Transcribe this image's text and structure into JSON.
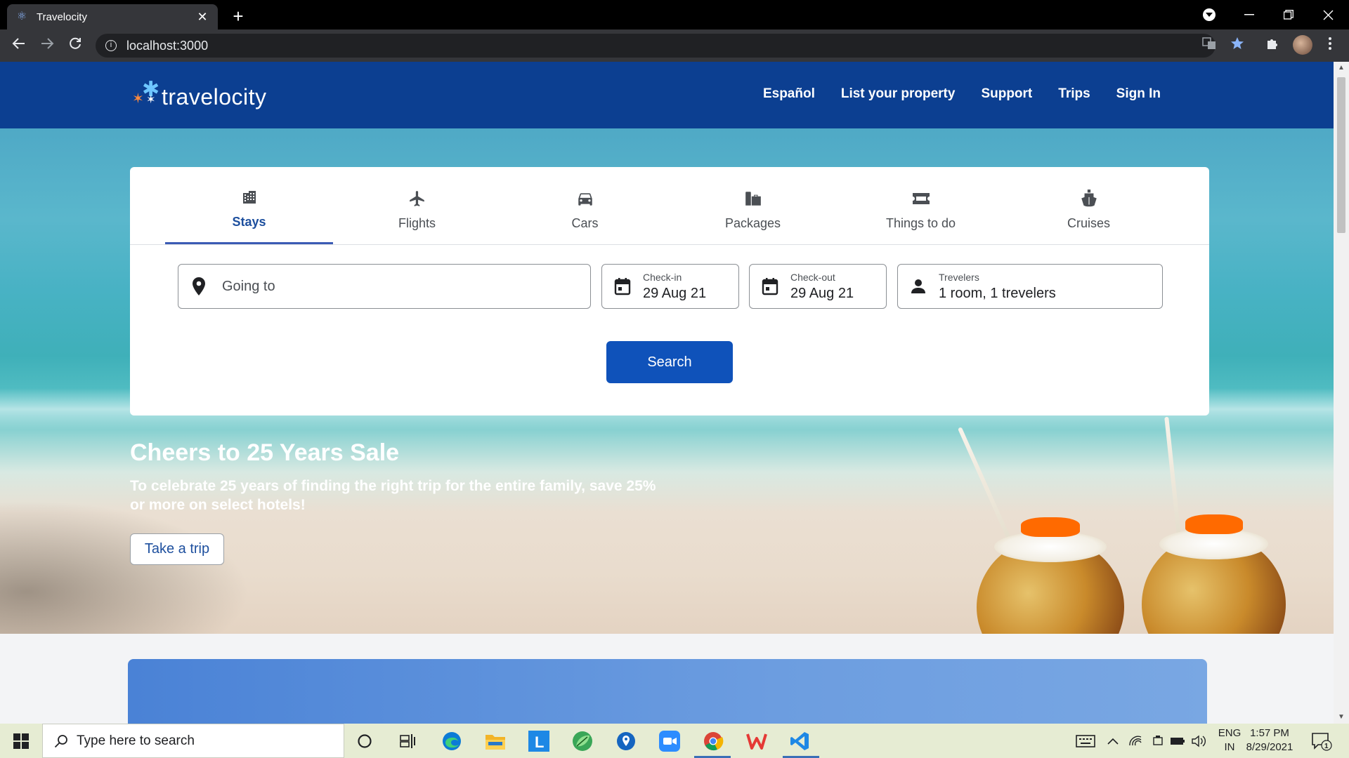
{
  "browser": {
    "tab_title": "Travelocity",
    "url": "localhost:3000",
    "new_tab_symbol": "+",
    "close_symbol": "✕"
  },
  "site": {
    "logo_text": "travelocity",
    "nav": [
      "Español",
      "List your property",
      "Support",
      "Trips",
      "Sign In"
    ]
  },
  "search": {
    "tabs": [
      {
        "label": "Stays",
        "icon": "building-icon",
        "active": true
      },
      {
        "label": "Flights",
        "icon": "plane-icon",
        "active": false
      },
      {
        "label": "Cars",
        "icon": "car-icon",
        "active": false
      },
      {
        "label": "Packages",
        "icon": "packages-icon",
        "active": false
      },
      {
        "label": "Things to do",
        "icon": "ticket-icon",
        "active": false
      },
      {
        "label": "Cruises",
        "icon": "ship-icon",
        "active": false
      }
    ],
    "going_to_placeholder": "Going to",
    "checkin_label": "Check-in",
    "checkin_value": "29 Aug 21",
    "checkout_label": "Check-out",
    "checkout_value": "29 Aug 21",
    "travelers_label": "Trevelers",
    "travelers_value": "1 room, 1 trevelers",
    "search_button": "Search"
  },
  "promo": {
    "title": "Cheers to 25 Years Sale",
    "text": "To celebrate 25 years of finding the right trip for the entire family, save 25% or more on select hotels!",
    "button": "Take a trip"
  },
  "taskbar": {
    "search_placeholder": "Type here to search",
    "lang_line1": "ENG",
    "lang_line2": "IN",
    "time": "1:57 PM",
    "date": "8/29/2021",
    "notification_count": "1",
    "apps": [
      "cortana-icon",
      "task-view-icon",
      "edge-icon",
      "file-explorer-icon",
      "l-app-icon",
      "leaf-app-icon",
      "maps-icon",
      "zoom-icon",
      "chrome-icon",
      "wps-icon",
      "vscode-icon"
    ]
  },
  "colors": {
    "header_blue": "#0c3f91",
    "button_blue": "#0f52ba",
    "active_tab": "#1d4f9e"
  }
}
